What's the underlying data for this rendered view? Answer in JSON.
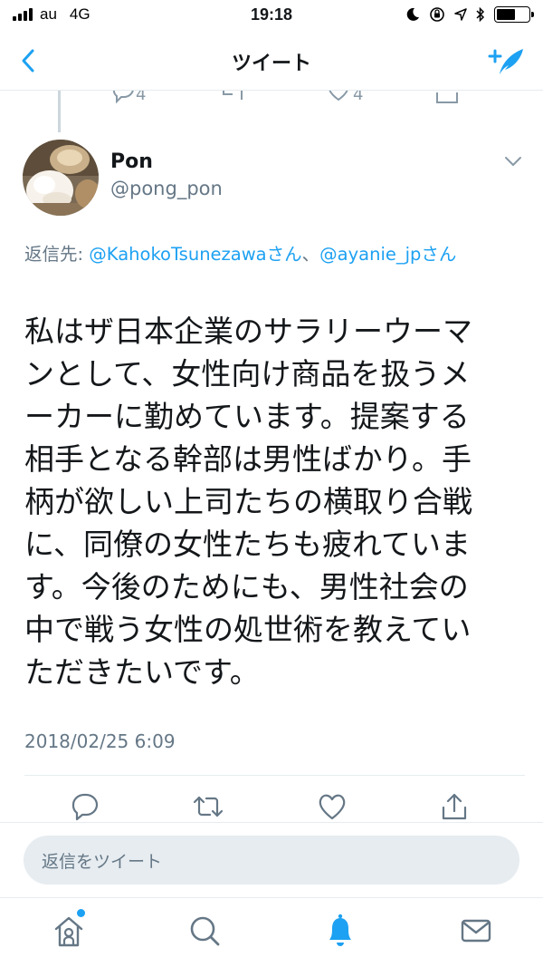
{
  "status_bar": {
    "carrier": "au",
    "network": "4G",
    "time": "19:18"
  },
  "nav": {
    "title": "ツイート"
  },
  "prev_tweet_actions": {
    "reply_count": "4",
    "like_count": "4"
  },
  "tweet": {
    "author_name": "Pon",
    "author_handle": "@pong_pon",
    "reply_prefix": "返信先: ",
    "reply_mention_1": "@KahokoTsunezawaさん",
    "reply_separator": "、",
    "reply_mention_2": "@ayanie_jpさん",
    "text": "私はザ日本企業のサラリーウーマ\nンとして、女性向け商品を扱うメ\nーカーに勤めています。提案する\n相手となる幹部は男性ばかり。手\n柄が欲しい上司たちの横取り合戦\nに、同僚の女性たちも疲れていま\nす。今後のためにも、男性社会の\n中で戦う女性の処世術を教えてい\nただきたいです。",
    "timestamp": "2018/02/25 6:09"
  },
  "reply_box": {
    "placeholder": "返信をツイート"
  },
  "colors": {
    "accent": "#1da1f2",
    "secondary_text": "#657786",
    "icon_gray": "#657786"
  },
  "icons": {
    "back": "chevron-left-icon",
    "compose": "compose-tweet-icon",
    "reply": "reply-icon",
    "retweet": "retweet-icon",
    "like": "heart-icon",
    "share": "share-icon",
    "home": "home-icon",
    "search": "search-icon",
    "notifications": "bell-icon",
    "messages": "envelope-icon"
  }
}
